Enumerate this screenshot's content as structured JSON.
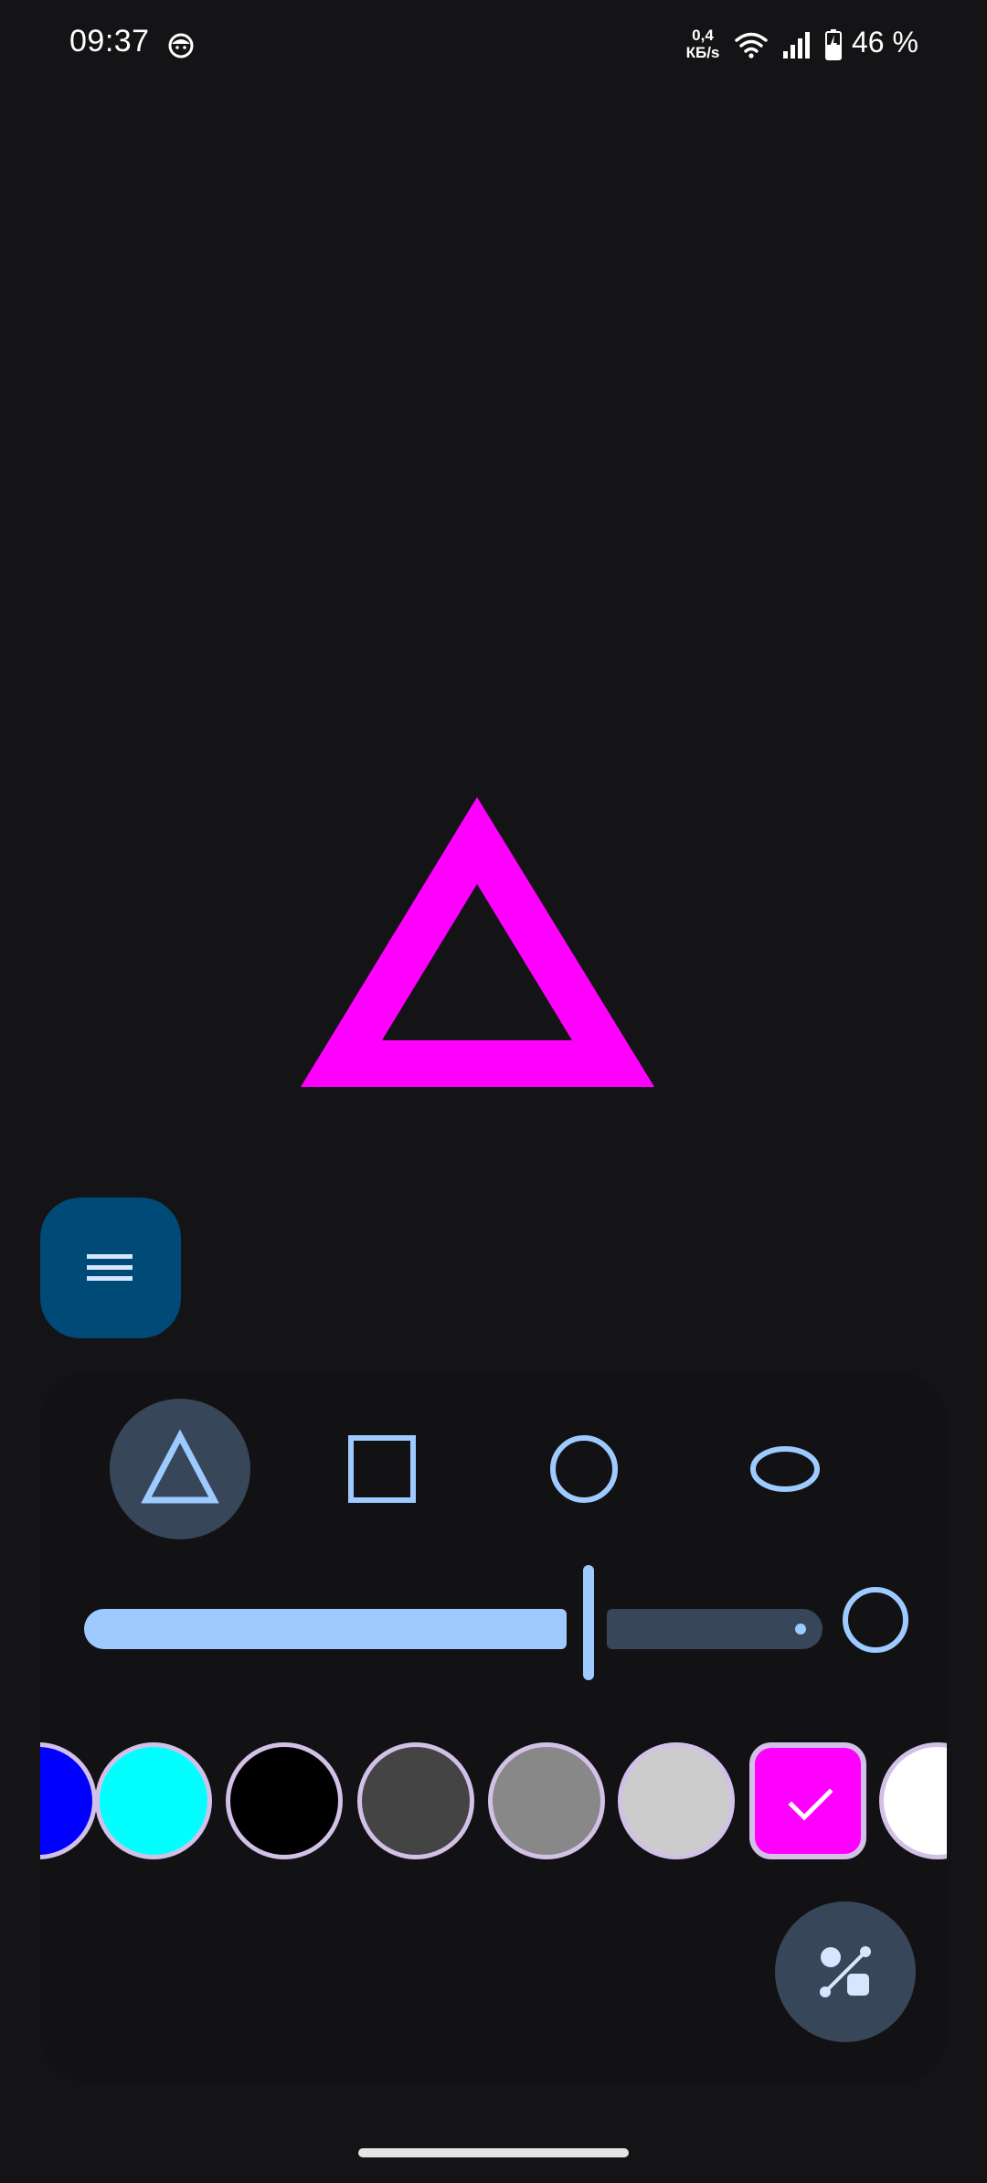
{
  "status_bar": {
    "time": "09:37",
    "speed_value": "0,4",
    "speed_unit": "КБ/s",
    "battery_percent": "46 %",
    "icons": [
      "notification-face-icon",
      "wifi-icon",
      "signal-icon",
      "battery-charging-icon"
    ]
  },
  "canvas": {
    "drawn_shape": "triangle",
    "drawn_shape_color": "#ff00ff"
  },
  "menu_button": {
    "icon": "menu-icon"
  },
  "shape_picker": {
    "options": [
      {
        "name": "triangle",
        "icon": "triangle-icon",
        "selected": true
      },
      {
        "name": "square",
        "icon": "square-icon",
        "selected": false
      },
      {
        "name": "circle",
        "icon": "circle-icon",
        "selected": false
      },
      {
        "name": "ellipse",
        "icon": "ellipse-icon",
        "selected": false
      }
    ]
  },
  "stroke_slider": {
    "value_fraction": 0.63
  },
  "palette": {
    "swatches": [
      {
        "color": "#0000ff",
        "selected": false
      },
      {
        "color": "#00ffff",
        "selected": false
      },
      {
        "color": "#000000",
        "selected": false
      },
      {
        "color": "#444444",
        "selected": false
      },
      {
        "color": "#888888",
        "selected": false
      },
      {
        "color": "#cccccc",
        "selected": false
      },
      {
        "color": "#ff00ff",
        "selected": true
      },
      {
        "color": "#ffffff",
        "selected": false
      }
    ]
  },
  "tools_button": {
    "icon": "shapes-tool-icon"
  },
  "theme": {
    "accent": "#9ecbff",
    "background": "#141416",
    "panel": "#121214"
  }
}
